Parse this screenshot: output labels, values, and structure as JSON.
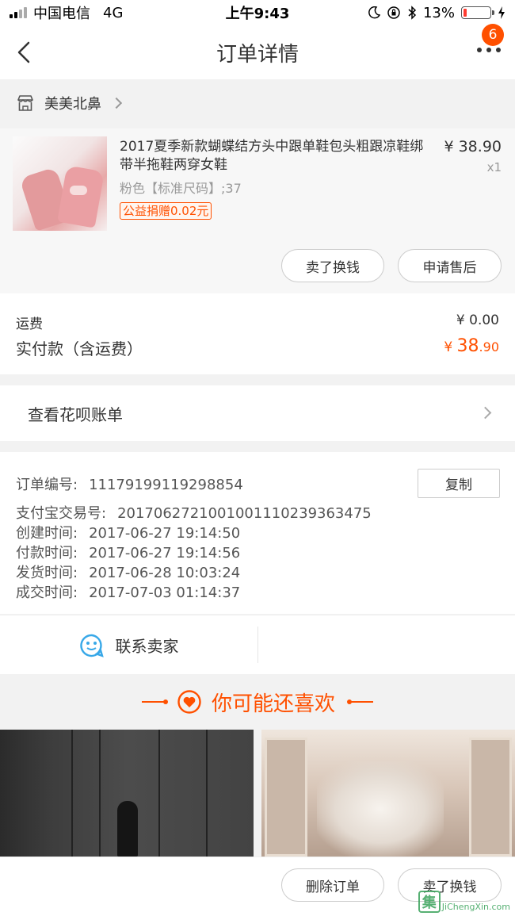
{
  "status_bar": {
    "carrier": "中国电信",
    "network": "4G",
    "time": "上午9:43",
    "battery_percent": "13%",
    "battery_level": 0.13
  },
  "navbar": {
    "title": "订单详情",
    "badge_count": "6"
  },
  "shop": {
    "name": "美美北鼻"
  },
  "item": {
    "title": "2017夏季新款蝴蝶结方头中跟单鞋包头粗跟凉鞋绑带半拖鞋两穿女鞋",
    "spec": "粉色【标准尺码】;37",
    "charity_tag": "公益捐赠0.02元",
    "price": "¥ 38.90",
    "quantity": "x1",
    "sell_button": "卖了换钱",
    "aftersale_button": "申请售后"
  },
  "fees": {
    "shipping_label": "运费",
    "shipping_value": "¥ 0.00",
    "paid_label": "实付款（含运费）",
    "paid_currency": "¥ ",
    "paid_integer": "38",
    "paid_decimal": ".90"
  },
  "huabei": {
    "label": "查看花呗账单"
  },
  "order_info": {
    "copy_button": "复制",
    "rows": [
      {
        "label": "订单编号:",
        "value": "11179199119298854"
      },
      {
        "label": "支付宝交易号:",
        "value": "2017062721001001110239363475"
      },
      {
        "label": "创建时间:",
        "value": "2017-06-27 19:14:50"
      },
      {
        "label": "付款时间:",
        "value": "2017-06-27 19:14:56"
      },
      {
        "label": "发货时间:",
        "value": "2017-06-28 10:03:24"
      },
      {
        "label": "成交时间:",
        "value": "2017-07-03 01:14:37"
      }
    ]
  },
  "contact": {
    "label": "联系卖家"
  },
  "recommend": {
    "title": "你可能还喜欢"
  },
  "bottom": {
    "delete_button": "删除订单",
    "sell_button": "卖了换钱"
  },
  "watermark": {
    "char": "集",
    "text": "JiChengXin.com"
  },
  "colors": {
    "accent": "#ff5000",
    "battery_low": "#ff3b30",
    "chat_icon": "#38a8e8"
  }
}
